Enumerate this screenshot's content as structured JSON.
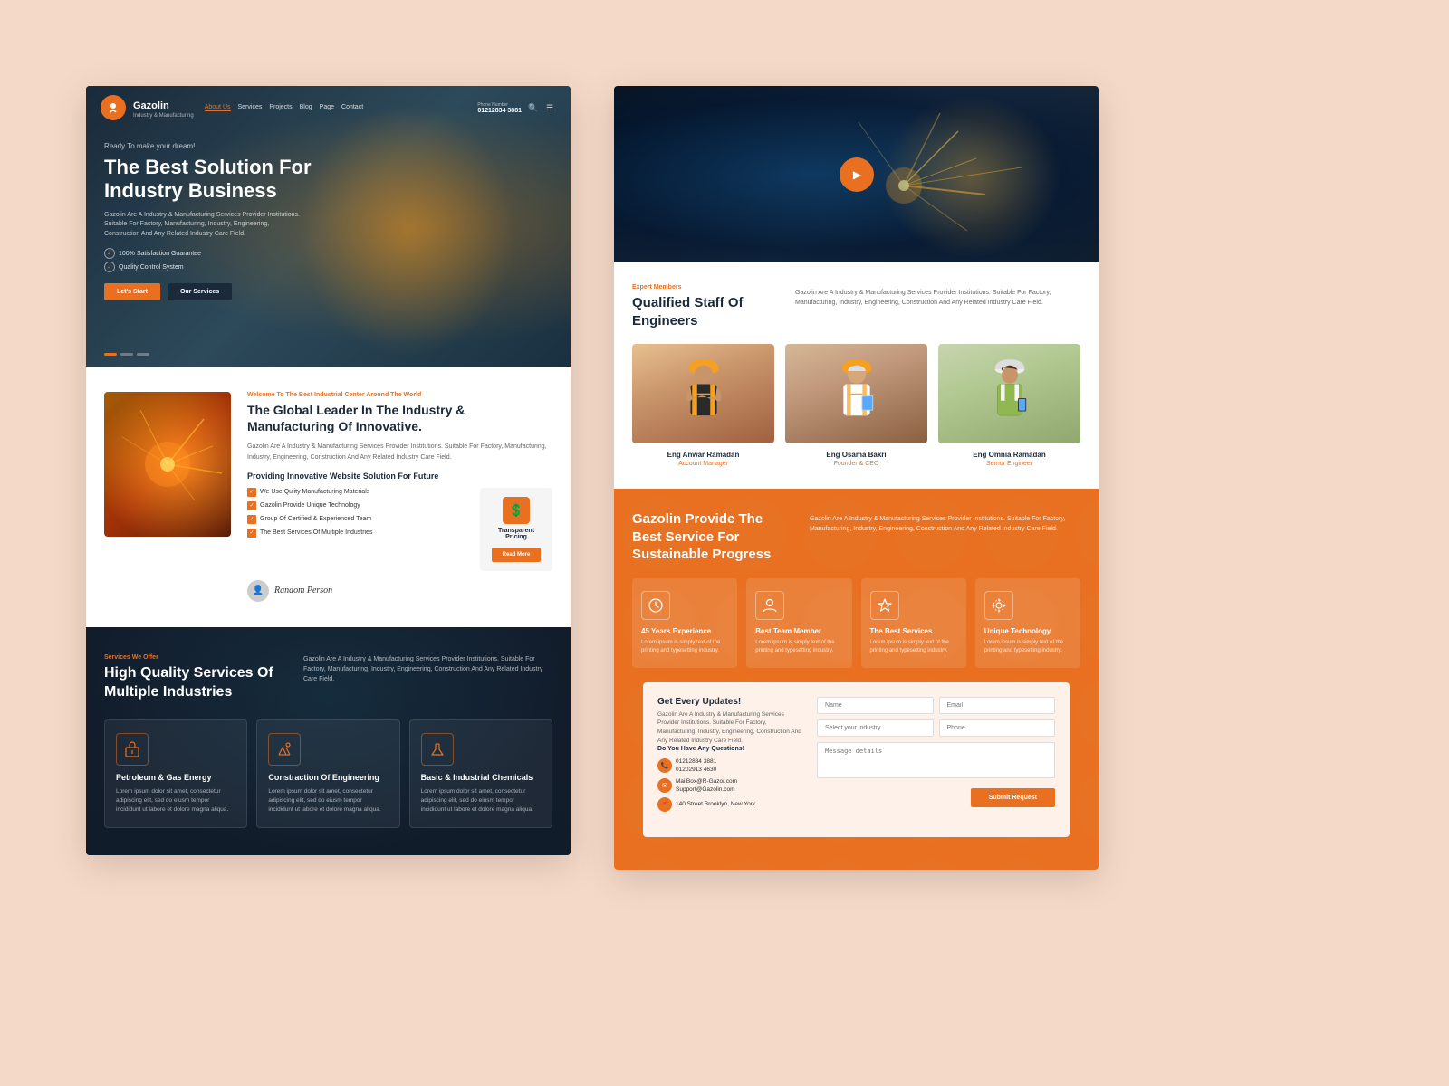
{
  "brand": {
    "name": "Gazolin",
    "tagline": "Industry & Manufacturing",
    "phone_label": "Phone Number",
    "phone": "01212834 3881"
  },
  "nav": {
    "links": [
      "About Us",
      "Services",
      "Projects",
      "Blog",
      "Page",
      "Contact"
    ],
    "active": "About Us"
  },
  "hero": {
    "tagline": "Ready To make your dream!",
    "title": "The Best Solution For Industry Business",
    "description": "Gazolin Are A Industry & Manufacturing Services Provider Institutions. Suitable For Factory, Manufacturing, Industry, Engineering, Construction And Any Related Industry Care Field.",
    "checks": [
      "100% Satisfaction Guarantee",
      "Quality Control System"
    ],
    "btn_start": "Let's Start",
    "btn_services": "Our Services"
  },
  "about": {
    "tag": "Welcome To The Best Industrial Center Around The World",
    "title": "The Global Leader In The Industry & Manufacturing Of Innovative.",
    "description": "Gazolin Are A Industry & Manufacturing Services Provider Institutions. Suitable For Factory, Manufacturing, Industry, Engineering, Construction And Any Related Industry Care Field.",
    "sub_title": "Providing Innovative Website Solution For Future",
    "features": [
      "We Use Qulity Manufacturing Materials",
      "Gazolin Provide Unique Technology",
      "Group Of Certified & Experienced Team",
      "The Best Services Of Multiple Industries"
    ],
    "pricing_label": "Transparent Pricing",
    "btn_read_more": "Read More",
    "signature": "Random Person"
  },
  "services": {
    "tag": "Services We Offer",
    "title": "High Quality Services Of Multiple Industries",
    "description": "Gazolin Are A Industry & Manufacturing Services Provider Institutions. Suitable For Factory, Manufacturing, Industry, Engineering, Construction And Any Related Industry Care Field.",
    "cards": [
      {
        "icon": "⚡",
        "title": "Petroleum & Gas Energy",
        "description": "Lorem ipsum dolor sit amet, consectetur adipiscing elit, sed do eiusm tempor incididunt ut labore et dolore magna aliqua."
      },
      {
        "icon": "🔧",
        "title": "Constraction Of Engineering",
        "description": "Lorem ipsum dolor sit amet, consectetur adipiscing elit, sed do eiusm tempor incididunt ut labore et dolore magna aliqua."
      },
      {
        "icon": "🧪",
        "title": "Basic & Industrial Chemicals",
        "description": "Lorem ipsum dolor sit amet, consectetur adipiscing elit, sed do eiusm tempor incididunt ut labore et dolore magna aliqua."
      }
    ]
  },
  "engineers": {
    "tag": "Expert Members",
    "title": "Qualified Staff Of Engineers",
    "description": "Gazolin Are A Industry & Manufacturing Services Provider Institutions. Suitable For Factory, Manufacturing, Industry, Engineering, Construction And Any Related Industry Care Field.",
    "members": [
      {
        "name": "Eng Anwar Ramadan",
        "role": "Account Manager"
      },
      {
        "name": "Eng Osama Bakri",
        "role": "Founder & CEO"
      },
      {
        "name": "Eng Omnia Ramadan",
        "role": "Sernor Engineer"
      }
    ]
  },
  "orange_section": {
    "title": "Gazolin Provide The Best Service For Sustainable Progress",
    "description": "Gazolin Are A Industry & Manufacturing Services Provider Institutions. Suitable For Factory, Manufacturing, Industry, Engineering, Construction And Any Related Industry Care Field.",
    "cards": [
      {
        "icon": "💡",
        "title": "45 Years Experience",
        "description": "Lorem ipsum is simply text of the printing and typesetting industry."
      },
      {
        "icon": "👤",
        "title": "Best Team Member",
        "description": "Lorem ipsum is simply text of the printing and typesetting industry."
      },
      {
        "icon": "⚙️",
        "title": "The Best Services",
        "description": "Lorem ipsum is simply text of the printing and typesetting industry."
      },
      {
        "icon": "🔬",
        "title": "Unique Technology",
        "description": "Lorem ipsum is simply text of the printing and typesetting industry."
      }
    ]
  },
  "contact": {
    "title": "Get Every Updates!",
    "description": "Gazolin Are A Industry & Manufacturing Services Provider Institutions. Suitable For Factory, Manufacturing, Industry, Engineering, Construction And Any Related Industry Care Field.",
    "question": "Do You Have Any Questions!",
    "phone1": "01212834 3881",
    "phone2": "01202913 4630",
    "email1": "MailBox@R-Gazor.com",
    "email2": "Support@Gazolin.com",
    "address": "140 Street Brooklyn, New York",
    "form": {
      "name_placeholder": "Name",
      "email_placeholder": "Email",
      "industry_placeholder": "Select your industry",
      "phone_placeholder": "Phone",
      "message_placeholder": "Message details",
      "submit": "Submit Request"
    }
  }
}
